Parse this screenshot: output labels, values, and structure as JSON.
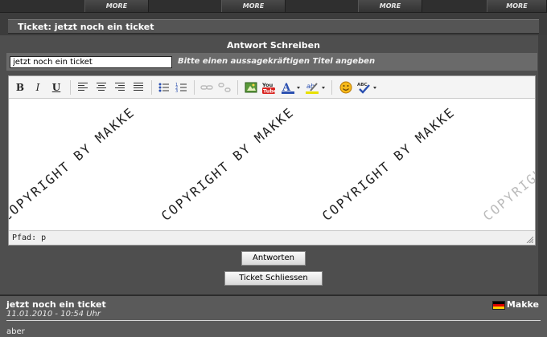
{
  "topnav": {
    "more_buttons": [
      "MORE",
      "MORE",
      "MORE",
      "MORE"
    ]
  },
  "ticket": {
    "title_bar": "Ticket: jetzt noch ein ticket"
  },
  "reply_form": {
    "header": "Antwort Schreiben",
    "title_value": "jetzt noch ein ticket",
    "title_hint": "Bitte einen aussagekräftigen Titel angeben",
    "status_path": "Pfad: p",
    "watermark": "COPYRIGHT BY MAKKE",
    "toolbar": {
      "bold": "B",
      "italic": "I",
      "underline": "U"
    },
    "reply_button": "Antworten",
    "close_button": "Ticket Schliessen"
  },
  "post": {
    "title": "jetzt noch ein ticket",
    "date": "11.01.2010 - 10:54 Uhr",
    "author": "Makke",
    "body": "aber"
  },
  "colors": {
    "panel": "#4e4e4e",
    "title_row": "#6a6a6a",
    "post_bg": "#5a5a5a",
    "flag_black": "#000000",
    "flag_red": "#dd0000",
    "flag_gold": "#ffce00"
  }
}
